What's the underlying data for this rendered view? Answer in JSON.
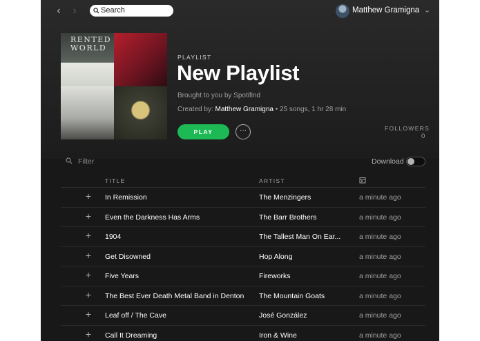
{
  "topbar": {
    "back_glyph": "‹",
    "forward_glyph": "›",
    "search_placeholder": "Search",
    "user_name": "Matthew Gramigna",
    "user_menu_glyph": "⌄"
  },
  "playlist": {
    "cover_text": "RENTED WORLD",
    "type_label": "PLAYLIST",
    "title": "New Playlist",
    "subtitle": "Brought to you by Spotifind",
    "created_by_label": "Created by: ",
    "owner": "Matthew Gramigna",
    "stats": " • 25 songs, 1 hr 28 min",
    "play_label": "PLAY",
    "more_glyph": "···",
    "followers_label": "FOLLOWERS",
    "followers_count": "0"
  },
  "filter": {
    "placeholder": "Filter",
    "download_label": "Download",
    "download_enabled": false
  },
  "table": {
    "columns": {
      "title": "TITLE",
      "artist": "ARTIST"
    },
    "add_glyph": "+",
    "rows": [
      {
        "title": "In Remission",
        "artist": "The Menzingers",
        "added": "a minute ago"
      },
      {
        "title": "Even the Darkness Has Arms",
        "artist": "The Barr Brothers",
        "added": "a minute ago"
      },
      {
        "title": "1904",
        "artist": "The Tallest Man On Ear...",
        "added": "a minute ago"
      },
      {
        "title": "Get Disowned",
        "artist": "Hop Along",
        "added": "a minute ago"
      },
      {
        "title": "Five Years",
        "artist": "Fireworks",
        "added": "a minute ago"
      },
      {
        "title": "The Best Ever Death Metal Band in Denton",
        "artist": "The Mountain Goats",
        "added": "a minute ago"
      },
      {
        "title": "Leaf off / The Cave",
        "artist": "José González",
        "added": "a minute ago"
      },
      {
        "title": "Call It Dreaming",
        "artist": "Iron & Wine",
        "added": "a minute ago"
      }
    ]
  },
  "colors": {
    "accent": "#1db954",
    "background": "#181818"
  },
  "icons": {
    "search": "search-icon",
    "filter": "search-icon",
    "date_column": "calendar-icon"
  }
}
